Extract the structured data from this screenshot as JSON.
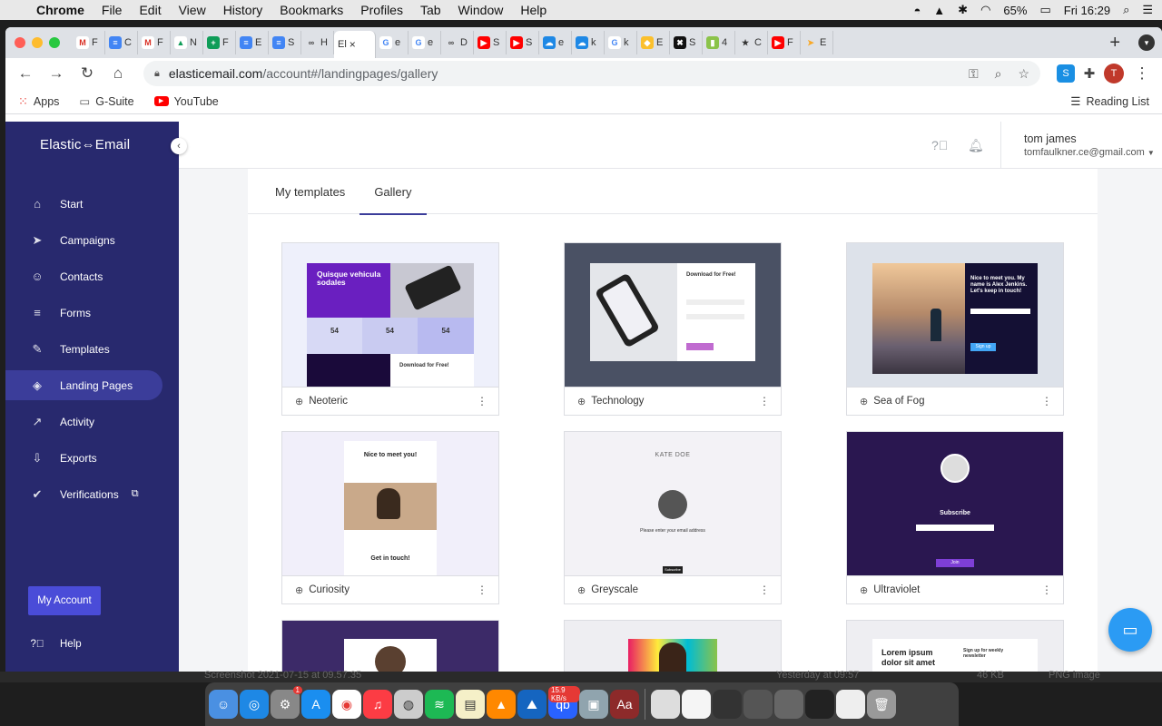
{
  "menubar": {
    "app": "Chrome",
    "items": [
      "File",
      "Edit",
      "View",
      "History",
      "Bookmarks",
      "Profiles",
      "Tab",
      "Window",
      "Help"
    ],
    "battery": "65%",
    "clock": "Fri 16:29"
  },
  "browser": {
    "tabs": [
      {
        "letter": "M",
        "title": "F",
        "color": "#ffffff",
        "fg": "#d93025"
      },
      {
        "letter": "≡",
        "title": "C",
        "color": "#4285f4",
        "fg": "#ffffff"
      },
      {
        "letter": "M",
        "title": "F",
        "color": "#ffffff",
        "fg": "#d93025"
      },
      {
        "letter": "▲",
        "title": "N",
        "color": "#ffffff",
        "fg": "#0f9d58"
      },
      {
        "letter": "+",
        "title": "F",
        "color": "#0f9d58",
        "fg": "#ffffff"
      },
      {
        "letter": "≡",
        "title": "E",
        "color": "#4285f4",
        "fg": "#ffffff"
      },
      {
        "letter": "≡",
        "title": "S",
        "color": "#4285f4",
        "fg": "#ffffff"
      },
      {
        "letter": "∞",
        "title": "H",
        "color": "#dee1e6",
        "fg": "#444444"
      },
      {
        "letter": "G",
        "title": "e",
        "color": "#ffffff",
        "fg": "#4285f4"
      },
      {
        "letter": "G",
        "title": "e",
        "color": "#ffffff",
        "fg": "#4285f4"
      },
      {
        "letter": "∞",
        "title": "D",
        "color": "#dee1e6",
        "fg": "#444444"
      },
      {
        "letter": "▶",
        "title": "S",
        "color": "#ff0000",
        "fg": "#ffffff"
      },
      {
        "letter": "▶",
        "title": "S",
        "color": "#ff0000",
        "fg": "#ffffff"
      },
      {
        "letter": "☁",
        "title": "e",
        "color": "#1e88e5",
        "fg": "#ffffff"
      },
      {
        "letter": "☁",
        "title": "k",
        "color": "#1e88e5",
        "fg": "#ffffff"
      },
      {
        "letter": "G",
        "title": "k",
        "color": "#ffffff",
        "fg": "#4285f4"
      },
      {
        "letter": "◆",
        "title": "E",
        "color": "#fbc02d",
        "fg": "#ffffff"
      },
      {
        "letter": "✖",
        "title": "S",
        "color": "#111111",
        "fg": "#ffffff"
      },
      {
        "letter": "▮",
        "title": "4",
        "color": "#8bc34a",
        "fg": "#ffffff"
      },
      {
        "letter": "★",
        "title": "C",
        "color": "#dee1e6",
        "fg": "#333333"
      },
      {
        "letter": "▶",
        "title": "F",
        "color": "#ff0000",
        "fg": "#ffffff"
      },
      {
        "letter": "➤",
        "title": "E",
        "color": "#dee1e6",
        "fg": "#f9a825"
      }
    ],
    "active_tab": {
      "title": "El",
      "close": "×"
    },
    "new_tab": "+",
    "url_host": "elasticemail.com",
    "url_path": "/account#/landingpages/gallery",
    "bookmarks": [
      {
        "label": "Apps",
        "icon": "apps-grid-icon"
      },
      {
        "label": "G-Suite",
        "icon": "folder-icon"
      },
      {
        "label": "YouTube",
        "icon": "youtube-icon"
      }
    ],
    "reading_list": "Reading List",
    "profile_initial": "T"
  },
  "sidebar": {
    "logo": "Elastic⇔Email",
    "items": [
      {
        "label": "Start",
        "icon": "home-icon",
        "glyph": "⌂"
      },
      {
        "label": "Campaigns",
        "icon": "paper-plane-icon",
        "glyph": "➤"
      },
      {
        "label": "Contacts",
        "icon": "contacts-icon",
        "glyph": "☺"
      },
      {
        "label": "Forms",
        "icon": "forms-icon",
        "glyph": "≡"
      },
      {
        "label": "Templates",
        "icon": "brush-icon",
        "glyph": "✎"
      },
      {
        "label": "Landing Pages",
        "icon": "layers-icon",
        "glyph": "◈",
        "active": true
      },
      {
        "label": "Activity",
        "icon": "activity-chart-icon",
        "glyph": "↗"
      },
      {
        "label": "Exports",
        "icon": "download-icon",
        "glyph": "⇩"
      },
      {
        "label": "Verifications",
        "icon": "verify-icon",
        "glyph": "✔"
      }
    ],
    "my_account": "My Account",
    "help": "Help"
  },
  "header": {
    "user_name": "tom james",
    "user_email": "tomfaulkner.ce@gmail.com"
  },
  "content": {
    "tabs": [
      {
        "label": "My templates",
        "active": false
      },
      {
        "label": "Gallery",
        "active": true
      }
    ],
    "templates": [
      {
        "name": "Neoteric"
      },
      {
        "name": "Technology"
      },
      {
        "name": "Sea of Fog"
      },
      {
        "name": "Curiosity"
      },
      {
        "name": "Greyscale"
      },
      {
        "name": "Ultraviolet"
      }
    ],
    "thumb_text": {
      "neoteric_heading": "Quisque vehicula sodales",
      "neoteric_stat": "54",
      "neoteric_download": "Download for Free!",
      "tech_download": "Download for Free!",
      "seafog_heading": "Nice to meet you. My name is Alex Jenkins. Let's keep in touch!",
      "seafog_button": "Sign up",
      "curiosity_heading": "Nice to meet you!",
      "curiosity_footer": "Get in touch!",
      "greyscale_name": "KATE DOE",
      "greyscale_prompt": "Please enter your email address",
      "greyscale_button": "Subscribe",
      "ultraviolet_heading": "Subscribe",
      "ultraviolet_button": "Join",
      "lorem_heading": "Lorem ipsum dolor sit amet",
      "lorem_side": "Sign up for weekly newsletter"
    }
  },
  "finder": {
    "file": "Screenshot 2021-07-15 at 09.57.35",
    "date": "Yesterday at 09:57",
    "size": "46 KB",
    "kind": "PNG image"
  },
  "dock": {
    "badge_mail": "1",
    "badge_torrent": "15.9 KB/s"
  }
}
